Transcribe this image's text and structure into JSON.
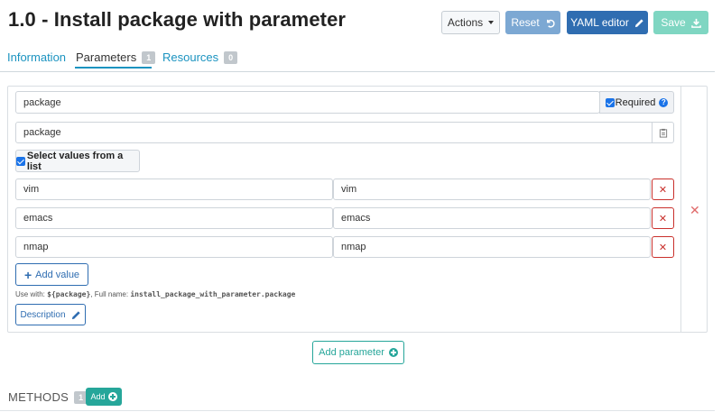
{
  "page": {
    "title": "1.0 - Install package with parameter"
  },
  "toolbar": {
    "actions_label": "Actions",
    "reset_label": "Reset",
    "yaml_label": "YAML editor",
    "save_label": "Save"
  },
  "tabs": [
    {
      "label": "Information",
      "badge": null
    },
    {
      "label": "Parameters",
      "badge": "1"
    },
    {
      "label": "Resources",
      "badge": "0"
    }
  ],
  "parameter": {
    "name_value": "package",
    "required_label": "Required",
    "label_value": "package",
    "select_list_label": "Select values from a list",
    "values": [
      {
        "value": "vim",
        "label": "vim"
      },
      {
        "value": "emacs",
        "label": "emacs"
      },
      {
        "value": "nmap",
        "label": "nmap"
      }
    ],
    "add_value_label": "Add value",
    "use_with_prefix": "Use with:",
    "use_with_var": "${package}",
    "full_name_prefix": ", Full name:",
    "full_name_value": "install_package_with_parameter.package",
    "description_label": "Description"
  },
  "add_parameter_label": "Add parameter",
  "methods": {
    "label": "METHODS",
    "count": "1",
    "add_label": "Add"
  },
  "colors": {
    "primary": "#2f6db1",
    "teal": "#26a69a",
    "danger": "#c9302c",
    "link": "#1b93c0"
  }
}
